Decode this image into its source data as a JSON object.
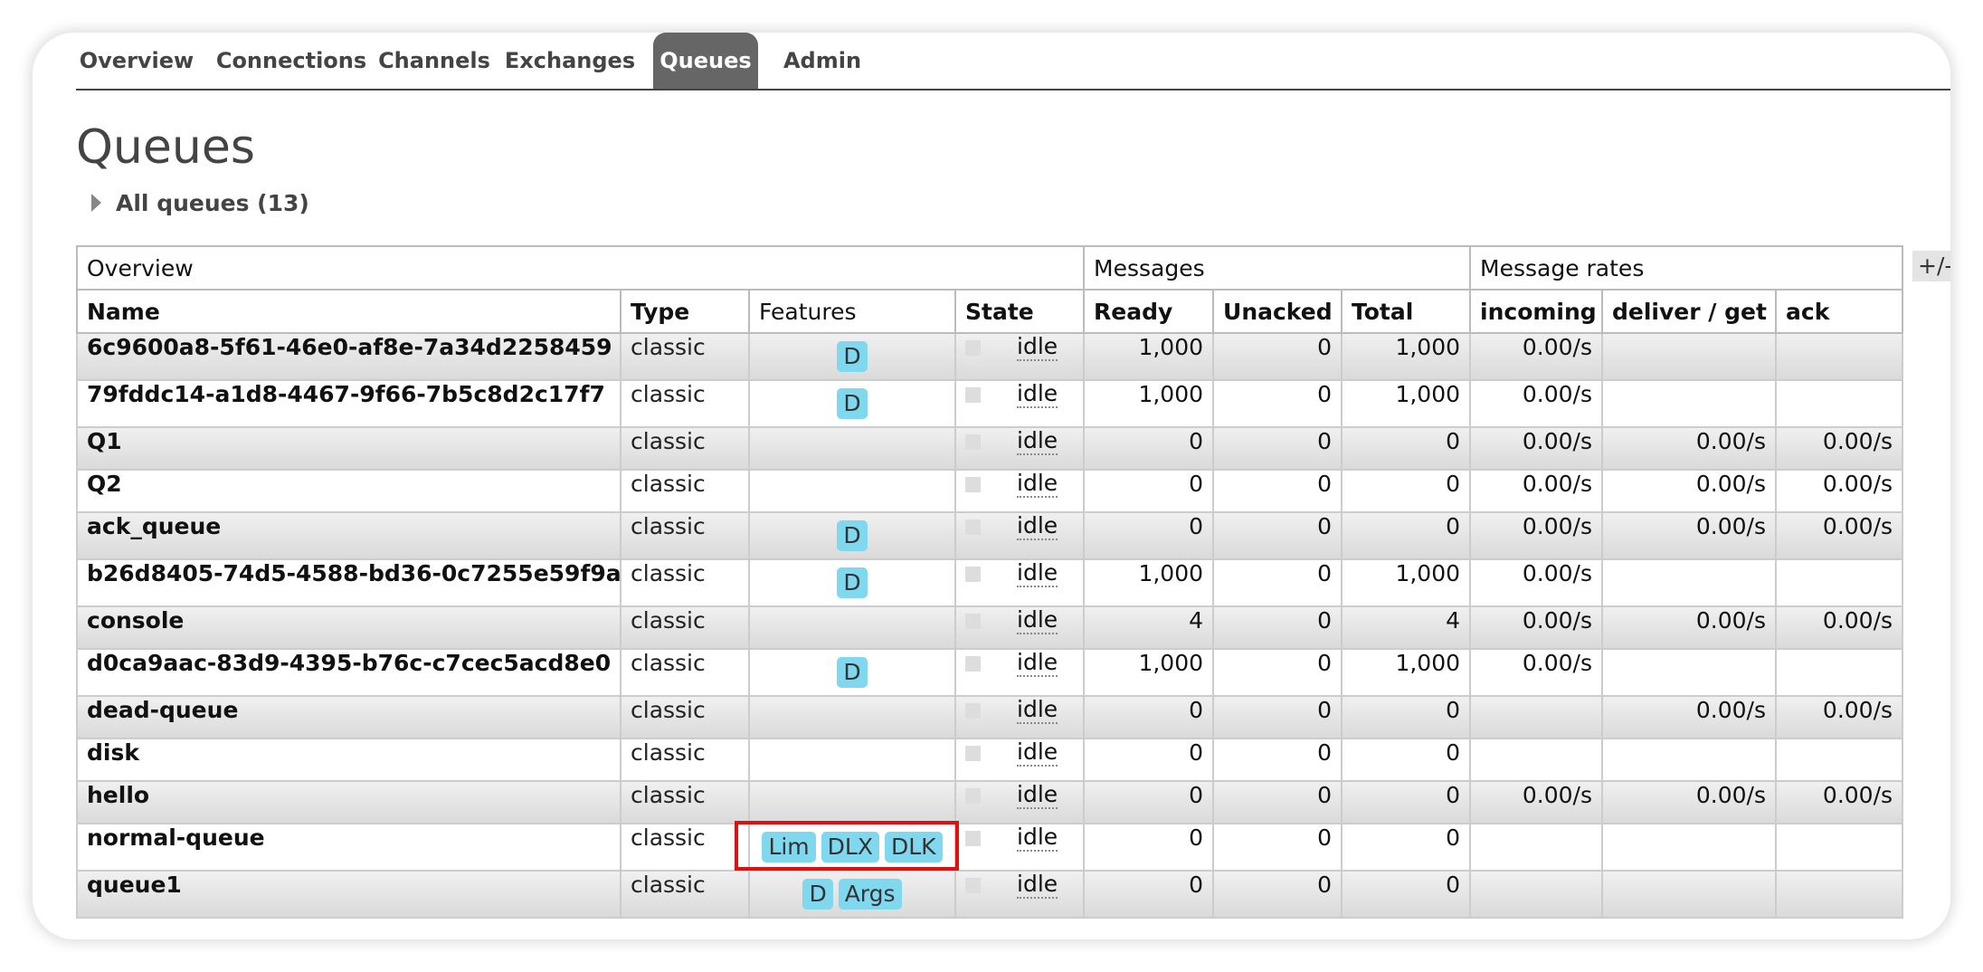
{
  "tabs": [
    {
      "label": "Overview",
      "active": false
    },
    {
      "label": "Connections",
      "active": false
    },
    {
      "label": "Channels",
      "active": false
    },
    {
      "label": "Exchanges",
      "active": false
    },
    {
      "label": "Queues",
      "active": true
    },
    {
      "label": "Admin",
      "active": false
    }
  ],
  "page": {
    "title": "Queues",
    "section_toggle": "All queues (13)",
    "columns_toggle": "+/-"
  },
  "table": {
    "groups": {
      "overview": "Overview",
      "messages": "Messages",
      "rates": "Message rates"
    },
    "columns": {
      "name": "Name",
      "type": "Type",
      "features": "Features",
      "state": "State",
      "ready": "Ready",
      "unacked": "Unacked",
      "total": "Total",
      "incoming": "incoming",
      "deliver": "deliver / get",
      "ack": "ack"
    },
    "rows": [
      {
        "name": "6c9600a8-5f61-46e0-af8e-7a34d2258459",
        "type": "classic",
        "features": [
          "D"
        ],
        "state": "idle",
        "ready": "1,000",
        "unacked": "0",
        "total": "1,000",
        "incoming": "0.00/s",
        "deliver": "",
        "ack": ""
      },
      {
        "name": "79fddc14-a1d8-4467-9f66-7b5c8d2c17f7",
        "type": "classic",
        "features": [
          "D"
        ],
        "state": "idle",
        "ready": "1,000",
        "unacked": "0",
        "total": "1,000",
        "incoming": "0.00/s",
        "deliver": "",
        "ack": ""
      },
      {
        "name": "Q1",
        "type": "classic",
        "features": [],
        "state": "idle",
        "ready": "0",
        "unacked": "0",
        "total": "0",
        "incoming": "0.00/s",
        "deliver": "0.00/s",
        "ack": "0.00/s"
      },
      {
        "name": "Q2",
        "type": "classic",
        "features": [],
        "state": "idle",
        "ready": "0",
        "unacked": "0",
        "total": "0",
        "incoming": "0.00/s",
        "deliver": "0.00/s",
        "ack": "0.00/s"
      },
      {
        "name": "ack_queue",
        "type": "classic",
        "features": [
          "D"
        ],
        "state": "idle",
        "ready": "0",
        "unacked": "0",
        "total": "0",
        "incoming": "0.00/s",
        "deliver": "0.00/s",
        "ack": "0.00/s"
      },
      {
        "name": "b26d8405-74d5-4588-bd36-0c7255e59f9a",
        "type": "classic",
        "features": [
          "D"
        ],
        "state": "idle",
        "ready": "1,000",
        "unacked": "0",
        "total": "1,000",
        "incoming": "0.00/s",
        "deliver": "",
        "ack": ""
      },
      {
        "name": "console",
        "type": "classic",
        "features": [],
        "state": "idle",
        "ready": "4",
        "unacked": "0",
        "total": "4",
        "incoming": "0.00/s",
        "deliver": "0.00/s",
        "ack": "0.00/s"
      },
      {
        "name": "d0ca9aac-83d9-4395-b76c-c7cec5acd8e0",
        "type": "classic",
        "features": [
          "D"
        ],
        "state": "idle",
        "ready": "1,000",
        "unacked": "0",
        "total": "1,000",
        "incoming": "0.00/s",
        "deliver": "",
        "ack": ""
      },
      {
        "name": "dead-queue",
        "type": "classic",
        "features": [],
        "state": "idle",
        "ready": "0",
        "unacked": "0",
        "total": "0",
        "incoming": "",
        "deliver": "0.00/s",
        "ack": "0.00/s"
      },
      {
        "name": "disk",
        "type": "classic",
        "features": [],
        "state": "idle",
        "ready": "0",
        "unacked": "0",
        "total": "0",
        "incoming": "",
        "deliver": "",
        "ack": ""
      },
      {
        "name": "hello",
        "type": "classic",
        "features": [],
        "state": "idle",
        "ready": "0",
        "unacked": "0",
        "total": "0",
        "incoming": "0.00/s",
        "deliver": "0.00/s",
        "ack": "0.00/s"
      },
      {
        "name": "normal-queue",
        "type": "classic",
        "features": [
          "Lim",
          "DLX",
          "DLK"
        ],
        "state": "idle",
        "ready": "0",
        "unacked": "0",
        "total": "0",
        "incoming": "",
        "deliver": "",
        "ack": ""
      },
      {
        "name": "queue1",
        "type": "classic",
        "features": [
          "D",
          "Args"
        ],
        "state": "idle",
        "ready": "0",
        "unacked": "0",
        "total": "0",
        "incoming": "",
        "deliver": "",
        "ack": ""
      }
    ]
  },
  "colors": {
    "badge": "#80d8ef",
    "active_tab": "#666666",
    "highlight": "#e01010"
  }
}
